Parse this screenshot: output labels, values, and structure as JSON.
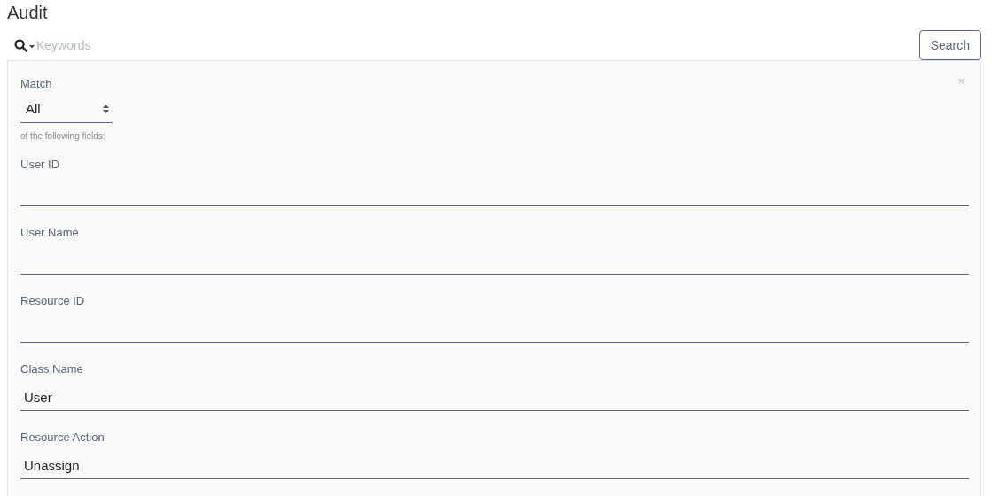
{
  "page": {
    "title": "Audit"
  },
  "search": {
    "placeholder": "Keywords",
    "button": "Search"
  },
  "panel": {
    "close": "×",
    "match_label": "Match",
    "match_value": "All",
    "match_hint": "of the following fields:",
    "fields": [
      {
        "label": "User ID"
      },
      {
        "label": "User Name"
      },
      {
        "label": "Resource ID"
      },
      {
        "label": "Class Name",
        "value": "User"
      },
      {
        "label": "Resource Action",
        "value": "Unassign"
      }
    ]
  }
}
